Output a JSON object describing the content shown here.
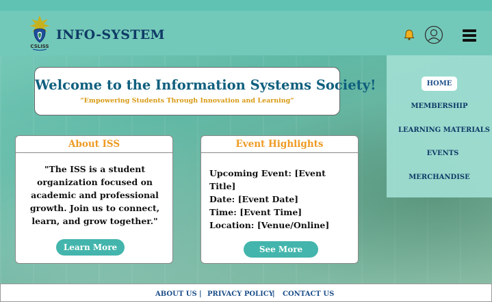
{
  "header": {
    "brand": "INFO-SYSTEM",
    "logo_text": "CSLISS"
  },
  "menu": {
    "items": [
      {
        "label": "HOME",
        "active": true
      },
      {
        "label": "MEMBERSHIP"
      },
      {
        "label": "LEARNING MATERIALS"
      },
      {
        "label": "EVENTS"
      },
      {
        "label": "MERCHANDISE"
      }
    ]
  },
  "welcome": {
    "title": "Welcome to the Information Systems Society!",
    "tagline": "“Empowering Students Through Innovation and Learning”"
  },
  "about": {
    "title": "About ISS",
    "text": "\"The ISS is a student organization focused on academic and professional growth. Join us to connect, learn, and grow together.\"",
    "button": "Learn More"
  },
  "events": {
    "title": "Event Highlights",
    "lines": [
      "Upcoming Event: [Event Title]",
      "Date: [Event Date]",
      "Time: [Event Time]",
      "Location: [Venue/Online]"
    ],
    "button": "See More"
  },
  "footer": {
    "links": [
      "ABOUT US",
      "PRIVACY POLICY",
      "CONTACT US"
    ],
    "separator": "|"
  },
  "colors": {
    "accent": "#43b5ac",
    "brand": "#0f3a66",
    "card_title": "#ee9a23",
    "tagline": "#d89a14",
    "bell": "#f2b01e"
  },
  "icons": [
    "bell-icon",
    "user-icon",
    "hamburger-menu-icon"
  ]
}
